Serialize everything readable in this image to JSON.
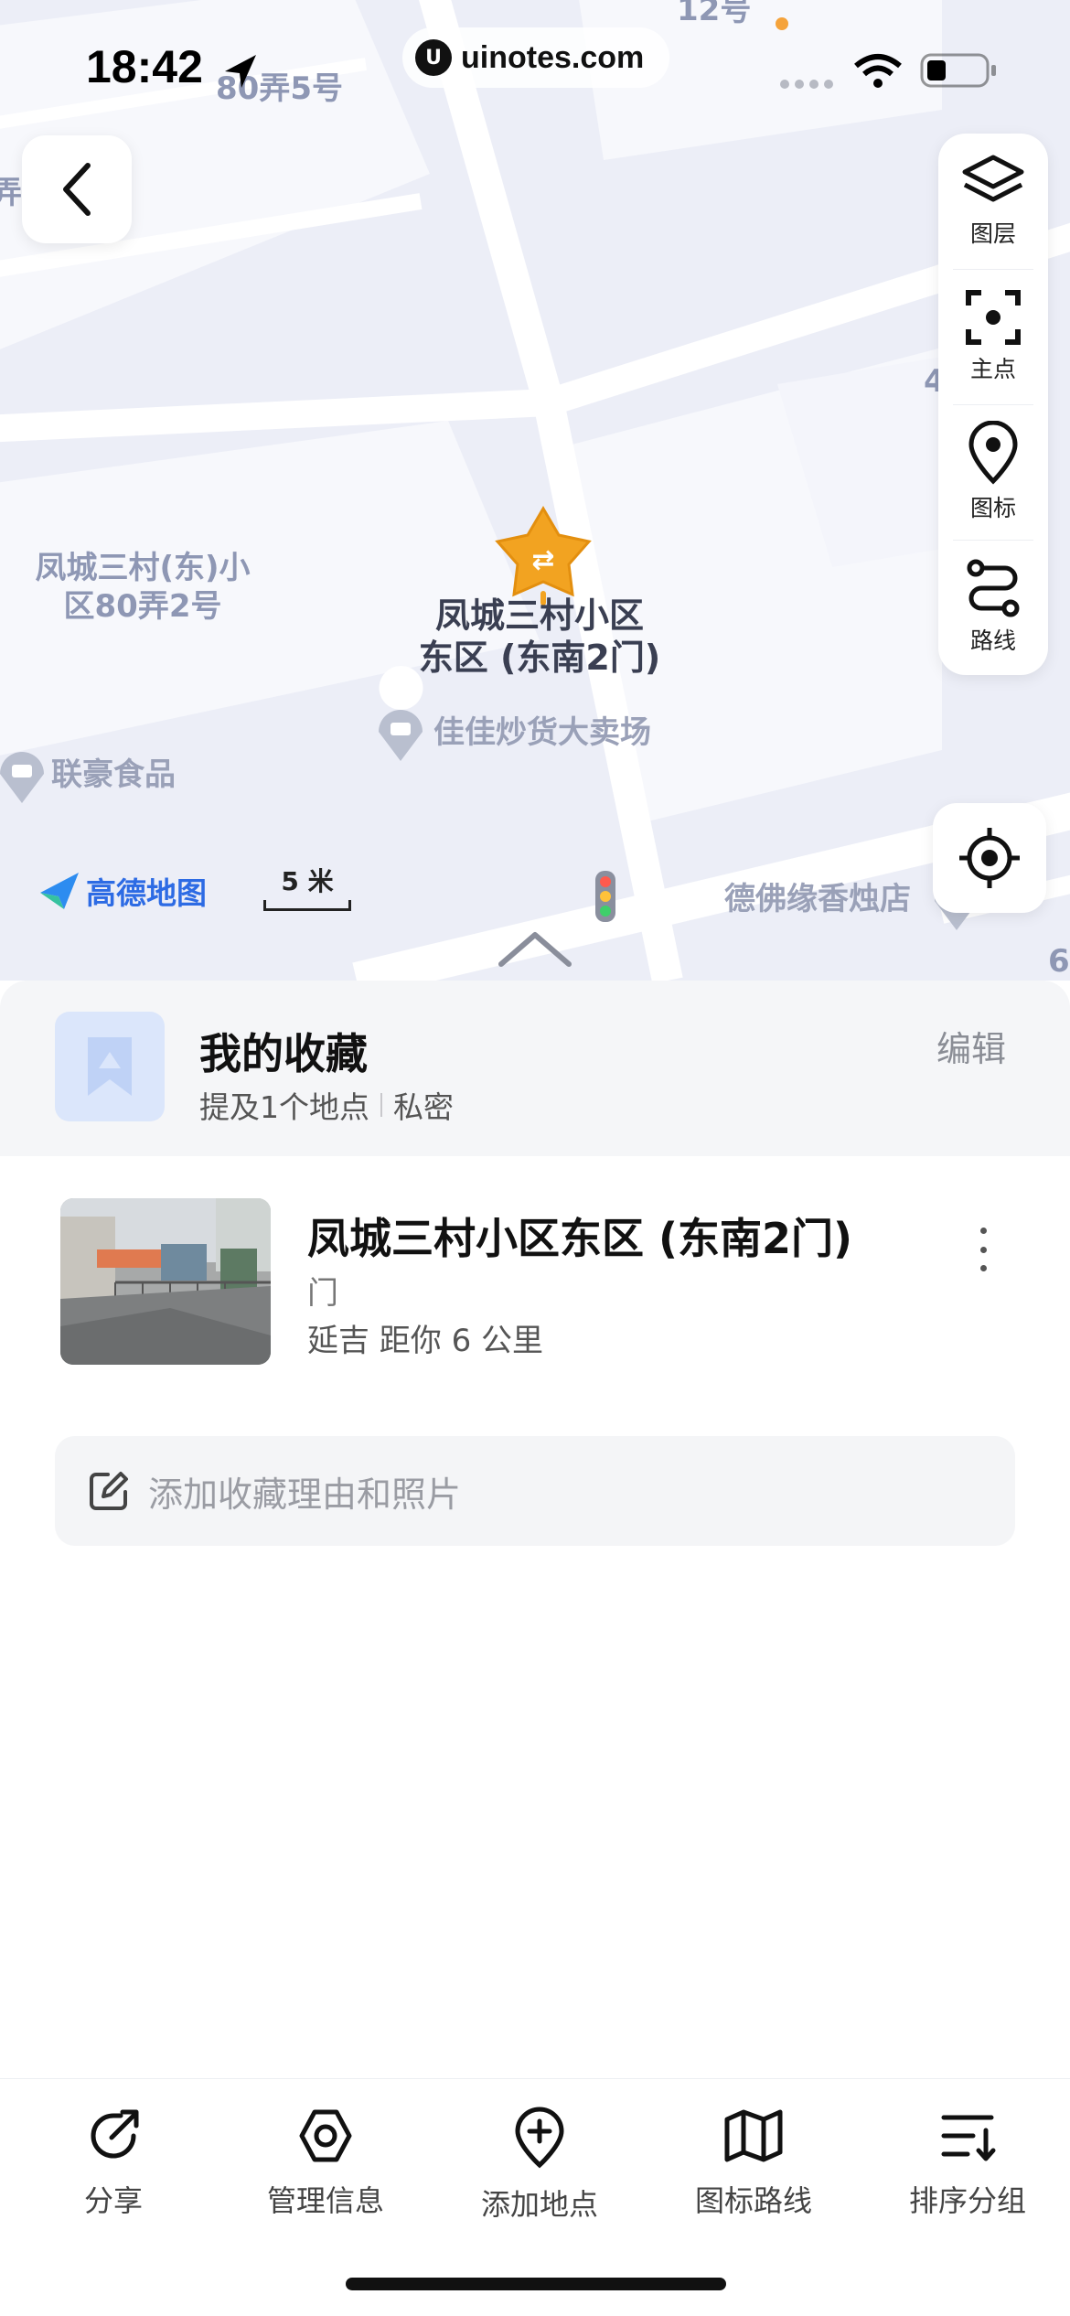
{
  "status_bar": {
    "time": "18:42",
    "url": "uinotes.com",
    "url_logo": "U"
  },
  "map": {
    "area_labels": [
      {
        "text": "80弄5号"
      },
      {
        "text": "12号"
      },
      {
        "text": "凤城三村(东)小区80弄2号"
      },
      {
        "text": "6"
      },
      {
        "text": "弄"
      },
      {
        "text": "4"
      }
    ],
    "pois": [
      {
        "name": "佳佳炒货大卖场",
        "icon": "basket-pin-icon"
      },
      {
        "name": "联豪食品",
        "icon": "basket-pin-icon"
      },
      {
        "name": "德佛缘香烛店",
        "icon": "shop-pin-icon"
      }
    ],
    "selected_pin": {
      "title_line1": "凤城三村小区",
      "title_line2": "东区 (东南2门)",
      "icon": "star-gate-icon"
    },
    "brand": "高德地图",
    "scale_text": "5 米",
    "tools": [
      {
        "label": "图层",
        "icon": "layers-icon"
      },
      {
        "label": "主点",
        "icon": "focus-point-icon"
      },
      {
        "label": "图标",
        "icon": "location-pin-icon"
      },
      {
        "label": "路线",
        "icon": "route-icon"
      }
    ],
    "colors": {
      "background": "#eceef7",
      "block": "#f7f8fc",
      "road": "#ffffff",
      "pin_orange": "#f2a321",
      "brand_blue": "#2d6be4"
    }
  },
  "favorites": {
    "title": "我的收藏",
    "count_text": "提及1个地点",
    "privacy": "私密",
    "edit_label": "编辑"
  },
  "place": {
    "name": "凤城三村小区东区 (东南2门)",
    "type": "门",
    "meta": "延吉   距你 6 公里"
  },
  "note": {
    "placeholder": "添加收藏理由和照片"
  },
  "toolbar": [
    {
      "label": "分享",
      "icon": "share-icon"
    },
    {
      "label": "管理信息",
      "icon": "settings-hexagon-icon"
    },
    {
      "label": "添加地点",
      "icon": "add-location-icon"
    },
    {
      "label": "图标路线",
      "icon": "map-route-icon"
    },
    {
      "label": "排序分组",
      "icon": "sort-icon"
    }
  ]
}
